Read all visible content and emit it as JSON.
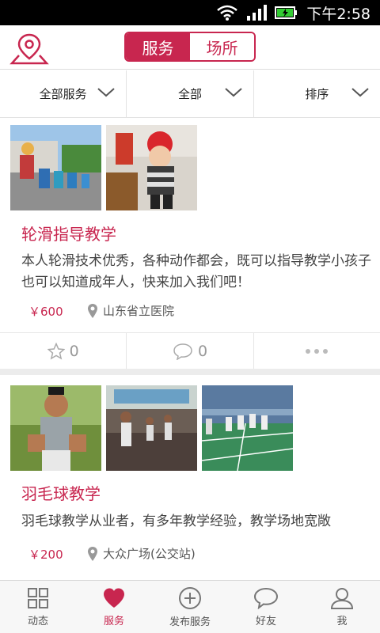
{
  "status_bar": {
    "time": "下午2:58"
  },
  "header": {
    "segment": {
      "active": "服务",
      "inactive": "场所"
    }
  },
  "filters": [
    {
      "label": "全部服务"
    },
    {
      "label": "全部"
    },
    {
      "label": "排序"
    }
  ],
  "listings": [
    {
      "title": "轮滑指导教学",
      "description": "本人轮滑技术优秀，各种动作都会，既可以指导教学小孩子也可以知道成年人，快来加入我们吧！",
      "price": "￥600",
      "location": "山东省立医院",
      "likes": "0",
      "comments": "0"
    },
    {
      "title": "羽毛球教学",
      "description": "羽毛球教学从业者，有多年教学经验，教学场地宽敞",
      "price": "￥200",
      "location": "大众广场(公交站)"
    }
  ],
  "tabbar": {
    "items": [
      {
        "label": "动态",
        "icon": "grid-icon"
      },
      {
        "label": "服务",
        "icon": "heart-icon"
      },
      {
        "label": "发布服务",
        "icon": "plus-circle-icon"
      },
      {
        "label": "好友",
        "icon": "chat-bubble-icon"
      },
      {
        "label": "我",
        "icon": "person-icon"
      }
    ],
    "active": "服务"
  },
  "colors": {
    "accent": "#c8264f",
    "text": "#444444",
    "muted": "#999999"
  }
}
